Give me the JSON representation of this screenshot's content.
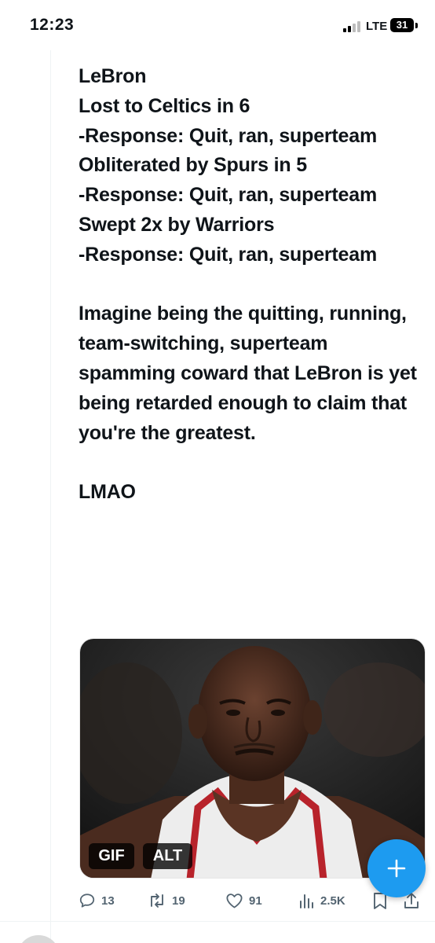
{
  "status_bar": {
    "time": "12:23",
    "network": "LTE",
    "battery": "31"
  },
  "tweet": {
    "text": "LeBron\nLost to Celtics in 6\n-Response: Quit, ran, superteam\nObliterated by Spurs in 5\n-Response: Quit, ran, superteam\nSwept 2x by Warriors\n-Response: Quit, ran, superteam\n\nImagine being the quitting, running, team-switching, superteam spamming coward that LeBron is yet being retarded enough to claim that you're the greatest.\n\nLMAO",
    "media": {
      "gif_badge": "GIF",
      "alt_badge": "ALT"
    },
    "actions": {
      "replies": "13",
      "reposts": "19",
      "likes": "91",
      "views": "2.5K"
    }
  },
  "colors": {
    "accent": "#1d9bf0",
    "action_gray": "#536471",
    "text": "#0f1419"
  },
  "icons": {
    "reply": "reply-icon",
    "repost": "repost-icon",
    "like": "heart-icon",
    "views": "views-chart-icon",
    "bookmark": "bookmark-icon",
    "share": "share-icon",
    "compose": "plus-icon"
  }
}
